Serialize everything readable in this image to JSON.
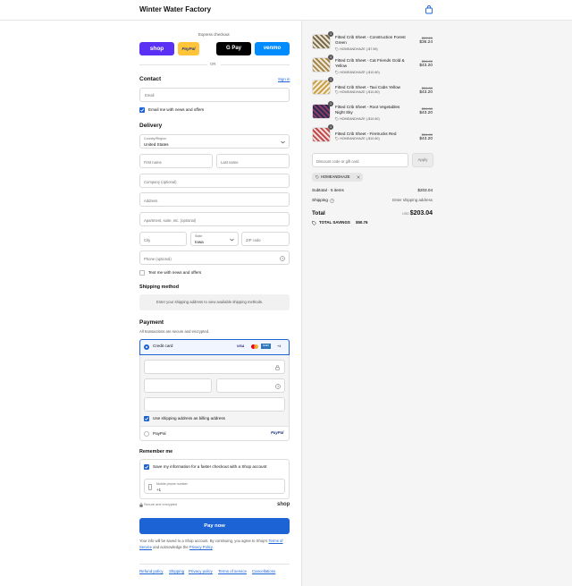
{
  "header": {
    "store_name": "Winter Water Factory"
  },
  "express": {
    "label": "Express checkout",
    "shop": "shop",
    "paypal": "PayPal",
    "gpay": "G Pay",
    "venmo": "venmo",
    "or": "OR"
  },
  "contact": {
    "heading": "Contact",
    "sign_in": "Sign in",
    "email_placeholder": "Email",
    "news_label": "Email me with news and offers",
    "news_checked": true
  },
  "delivery": {
    "heading": "Delivery",
    "country_label": "Country/Region",
    "country_value": "United States",
    "first_name": "First name",
    "last_name": "Last name",
    "company": "Company (optional)",
    "address": "Address",
    "apartment": "Apartment, suite, etc. (optional)",
    "city": "City",
    "state_label": "State",
    "state_value": "Iowa",
    "zip": "ZIP code",
    "phone": "Phone (optional)",
    "text_label": "Text me with news and offers"
  },
  "shipping": {
    "heading": "Shipping method",
    "notice": "Enter your shipping address to view available shipping methods."
  },
  "payment": {
    "heading": "Payment",
    "subtext": "All transactions are secure and encrypted.",
    "credit_card": "Credit card",
    "card_brands": [
      "VISA",
      "MC",
      "AMEX",
      "+4"
    ],
    "billing_label": "Use shipping address as billing address",
    "paypal_label": "PayPal",
    "paypal_logo": "PayPal"
  },
  "remember": {
    "heading": "Remember me",
    "save_label": "Save my information for a faster checkout with a Shop account",
    "phone_label": "Mobile phone number",
    "phone_value": "+1",
    "secure": "Secure and encrypted",
    "shop_logo": "shop"
  },
  "pay_button": "Pay now",
  "legal": {
    "line1": "Your info will be saved to a Shop account. By continuing, you agree to Shop's",
    "terms": "Terms of Service",
    "mid": "and acknowledge the",
    "privacy": "Privacy Policy",
    "end": "."
  },
  "footer_links": [
    "Refund policy",
    "Shipping",
    "Privacy policy",
    "Terms of service",
    "Cancellations"
  ],
  "cart": {
    "items": [
      {
        "qty": "1",
        "name": "Fitted Crib Sheet - Construction Forest Green",
        "discount": "HOMEANDHAZE (-$7.98)",
        "old": "$37.20",
        "price": "$36.24",
        "pattern": "forest"
      },
      {
        "qty": "1",
        "name": "Fitted Crib Sheet - Cat Friends Gold & Yellow",
        "discount": "HOMEANDHAZE (-$10.80)",
        "old": "$54.00",
        "price": "$43.20",
        "pattern": "gold"
      },
      {
        "qty": "1",
        "name": "Fitted Crib Sheet - Taxi Cabs Yellow",
        "discount": "HOMEANDHAZE (-$10.80)",
        "old": "$54.00",
        "price": "$43.20",
        "pattern": "taxi"
      },
      {
        "qty": "1",
        "name": "Fitted Crib Sheet - Root Vegetables Night Sky",
        "discount": "HOMEANDHAZE (-$10.80)",
        "old": "$54.00",
        "price": "$43.20",
        "pattern": "night"
      },
      {
        "qty": "1",
        "name": "Fitted Crib Sheet - Firetrucks Red",
        "discount": "HOMEANDHAZE (-$10.80)",
        "old": "$54.00",
        "price": "$43.20",
        "pattern": "red"
      }
    ],
    "discount_placeholder": "Discount code or gift card",
    "apply": "Apply",
    "applied_code": "HOMEANDHAZE",
    "subtotal_label": "Subtotal · 5 items",
    "subtotal": "$203.04",
    "shipping_label": "Shipping",
    "shipping_value": "Enter shipping address",
    "total_label": "Total",
    "currency": "USD",
    "total": "$203.04",
    "savings_label": "TOTAL SAVINGS",
    "savings": "$50.76"
  },
  "colors": {
    "accent": "#1c63d5",
    "shop": "#5a31f4",
    "paypal": "#ffc439",
    "gpay": "#000000",
    "venmo": "#008cff"
  }
}
